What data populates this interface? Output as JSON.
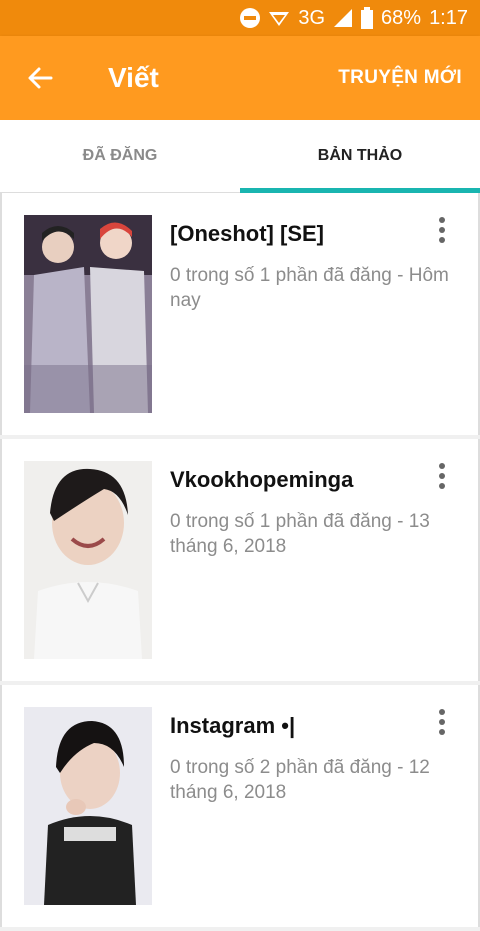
{
  "status_bar": {
    "network": "3G",
    "battery": "68%",
    "time": "1:17"
  },
  "app_bar": {
    "title": "Viết",
    "action_label": "TRUYỆN MỚI",
    "back_icon": "arrow-left-icon"
  },
  "tabs": [
    {
      "label": "ĐÃ ĐĂNG",
      "active": false
    },
    {
      "label": "BẢN THẢO",
      "active": true
    }
  ],
  "stories": [
    {
      "title": "[Oneshot] [SE]",
      "meta": "0 trong số 1 phần đã đăng - Hôm nay"
    },
    {
      "title": "Vkookhopeminga",
      "meta": "0 trong số 1 phần đã đăng - 13 tháng 6, 2018"
    },
    {
      "title": "Instagram •|",
      "meta": "0 trong số 2 phần đã đăng - 12 tháng 6, 2018"
    }
  ],
  "colors": {
    "status_bar": "#f08a0c",
    "app_bar": "#ff9a1f",
    "tab_indicator": "#19b5b0"
  }
}
